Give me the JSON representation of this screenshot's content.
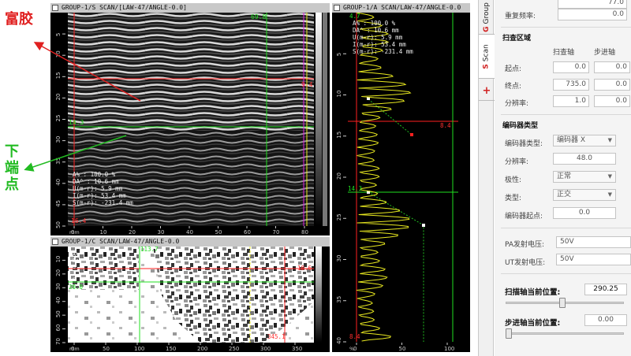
{
  "annotations": {
    "fujiao": "富胶",
    "xiaduan": "下端点"
  },
  "sscan": {
    "title": "GROUP-1/S SCAN/[LAW-47/ANGLE-0.0]",
    "marker_top": "69.8",
    "marker_right": "9.4",
    "marker_left": "14.3",
    "marker_bottom": "16.4",
    "readouts": [
      "A%  : 100.0 %",
      "DA^ : 10.6 mm",
      "U(m-r): 5.9 mm",
      "I(m-r): 53.4 mm",
      "S(m-r): -231.4 mm"
    ],
    "y_ticks": [
      "5",
      "10",
      "15",
      "20",
      "25",
      "30",
      "35",
      "40",
      "45",
      "50"
    ],
    "x_ticks": [
      "0",
      "10",
      "20",
      "30",
      "40",
      "50",
      "60",
      "70",
      "80"
    ],
    "x_unit": "mm"
  },
  "cscan": {
    "title": "GROUP-1/C SCAN/LAW-47/ANGLE-0.0",
    "marker_top": "113.7",
    "marker_right": "10.6",
    "marker_left": "20.0",
    "marker_bottom": "345.1",
    "readouts": [
      "A%",
      "DA^",
      "U",
      "I",
      "S"
    ],
    "y_ticks": [
      "10",
      "20",
      "30",
      "40",
      "50",
      "60",
      "70"
    ],
    "x_ticks": [
      "0",
      "50",
      "100",
      "150",
      "200",
      "250",
      "300",
      "350"
    ],
    "x_unit": "mm"
  },
  "ascan": {
    "title": "GROUP-1/A SCAN/LAW-47/ANGLE-0.0",
    "marker_top": "4.7",
    "marker_mid": "8.4",
    "marker_low": "14.3",
    "marker_bottom": "8.4",
    "readouts": [
      "A%  : 100.0 %",
      "DA^ : 10.6 mm",
      "U(m-r): 5.9 mm",
      "I(m-r): 53.4 mm",
      "S(m-r): -231.4 mm"
    ],
    "y_ticks": [
      "5",
      "10",
      "15",
      "20",
      "25",
      "30",
      "35",
      "40"
    ],
    "x_ticks": [
      "0",
      "50",
      "100"
    ],
    "x_unit": "%"
  },
  "tabs": {
    "group": "Group",
    "scan": "Scan",
    "add": "+"
  },
  "settings": {
    "top_value": "77.0",
    "rep_rate_label": "重复频率:",
    "rep_rate_value": "0.0",
    "scan_area": "扫查区域",
    "col_scan": "扫查轴",
    "col_index": "步进轴",
    "start_label": "起点:",
    "start_scan": "0.0",
    "start_index": "0.0",
    "end_label": "终点:",
    "end_scan": "735.0",
    "end_index": "0.0",
    "res_label": "分辨率:",
    "res_scan": "1.0",
    "res_index": "0.0",
    "encoder_type_section": "编码器类型",
    "encoder_type_label": "编码器类型:",
    "encoder_type_value": "编码器 X",
    "enc_res_label": "分辨率:",
    "enc_res_value": "48.0",
    "polarity_label": "极性:",
    "polarity_value": "正常",
    "type_label": "类型:",
    "type_value": "正交",
    "enc_start_label": "编码器起点:",
    "enc_start_value": "0.0",
    "pa_voltage_label": "PA发射电压:",
    "pa_voltage_value": "50V",
    "ut_voltage_label": "UT发射电压:",
    "ut_voltage_value": "50V",
    "scan_pos_label": "扫描轴当前位置:",
    "scan_pos_value": "290.25",
    "index_pos_label": "步进轴当前位置:",
    "index_pos_value": "0.00"
  },
  "colors": {
    "panel_bg": "#000000",
    "red_cursor": "#ff2020",
    "green_cursor": "#20e020",
    "magenta_cursor": "#e020e0",
    "yellow_cursor": "#e8e820",
    "ascan_trace": "#e8e820"
  },
  "sliders": {
    "scan_position_fraction": 0.48,
    "index_position_fraction": 0.0
  }
}
